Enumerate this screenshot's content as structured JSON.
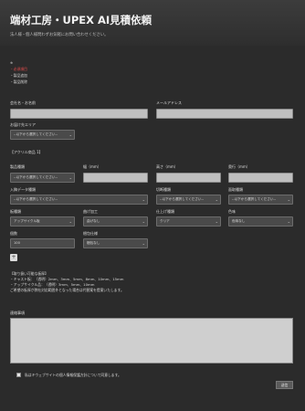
{
  "header": {
    "title": "端材工房・UPEX AI見積依頼",
    "subtitle": "法人様・個人様問わずお気軽にお問い合わせください。"
  },
  "steps": {
    "marker": "※",
    "items": [
      "・必須項目",
      "・製品追加",
      "・製品削除"
    ]
  },
  "fields": {
    "company": "会社名・お名前",
    "email": "メールアドレス",
    "area_label": "お届け先エリア",
    "area_placeholder": "--以下から選択してください--"
  },
  "product": {
    "heading": "【アクリル商品 1】",
    "type_label": "製品種類",
    "type_value": "--以下から選択してください--",
    "width_label": "幅（mm）",
    "height_label": "高さ（mm）",
    "depth_label": "奥行（mm）",
    "mount_label": "入稿データ種類",
    "mount_value": "--以下から選択してください--",
    "cut_label": "切断種類",
    "cut_value": "--以下から選択してください--",
    "corner_label": "面取種類",
    "corner_value": "--以下から選択してください--",
    "material_label": "板種類",
    "material_value": "アップサイクル板",
    "bend_label": "曲げ加工",
    "bend_value": "曲げなし",
    "finish_label": "仕上げ種類",
    "finish_value": "クリア",
    "color_label": "色味",
    "color_value": "色味なし",
    "qty_label": "個数",
    "qty_value": "100",
    "pack_label": "梱包仕様",
    "pack_value": "梱包なし"
  },
  "add_button": "+",
  "notes": {
    "title": "【取り扱い可能な板厚】",
    "line1": "・キャスト板：（透明）2mm、3mm、5mm、8mm、10mm、15mm",
    "line2": "・アップサイクル品：（透明）3mm、5mm、10mm",
    "line3": "ご希望の板厚が弊社対応範囲外となった場合は代替案を提案いたします。"
  },
  "message_label": "連絡事項",
  "consent": "私はキウェブサイトの個人情報保護方針について同意します。",
  "submit_label": "送信",
  "colors": {
    "background": "#2b2b2b",
    "required": "#e04b4b",
    "input": "#bfbfbf"
  }
}
